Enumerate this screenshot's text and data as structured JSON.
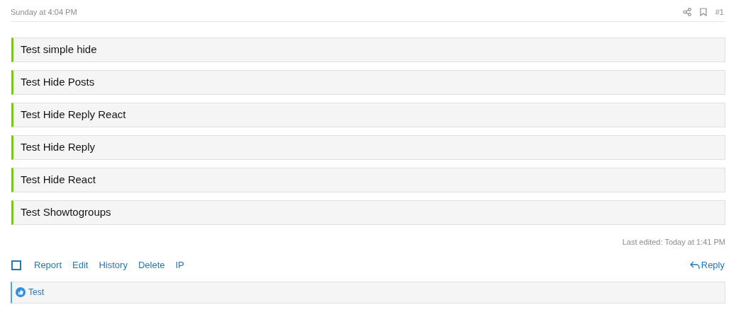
{
  "post_header": {
    "date": "Sunday at 4:04 PM",
    "number": "#1"
  },
  "blocks": [
    {
      "text": "Test simple hide"
    },
    {
      "text": "Test Hide Posts"
    },
    {
      "text": "Test Hide Reply React"
    },
    {
      "text": "Test Hide Reply"
    },
    {
      "text": "Test Hide React"
    },
    {
      "text": "Test Showtogroups"
    }
  ],
  "last_edited": "Last edited: Today at 1:41 PM",
  "actions": {
    "select_checked": false,
    "links": [
      "Report",
      "Edit",
      "History",
      "Delete",
      "IP"
    ],
    "reply": "Reply"
  },
  "reactions": {
    "text": "Test"
  }
}
